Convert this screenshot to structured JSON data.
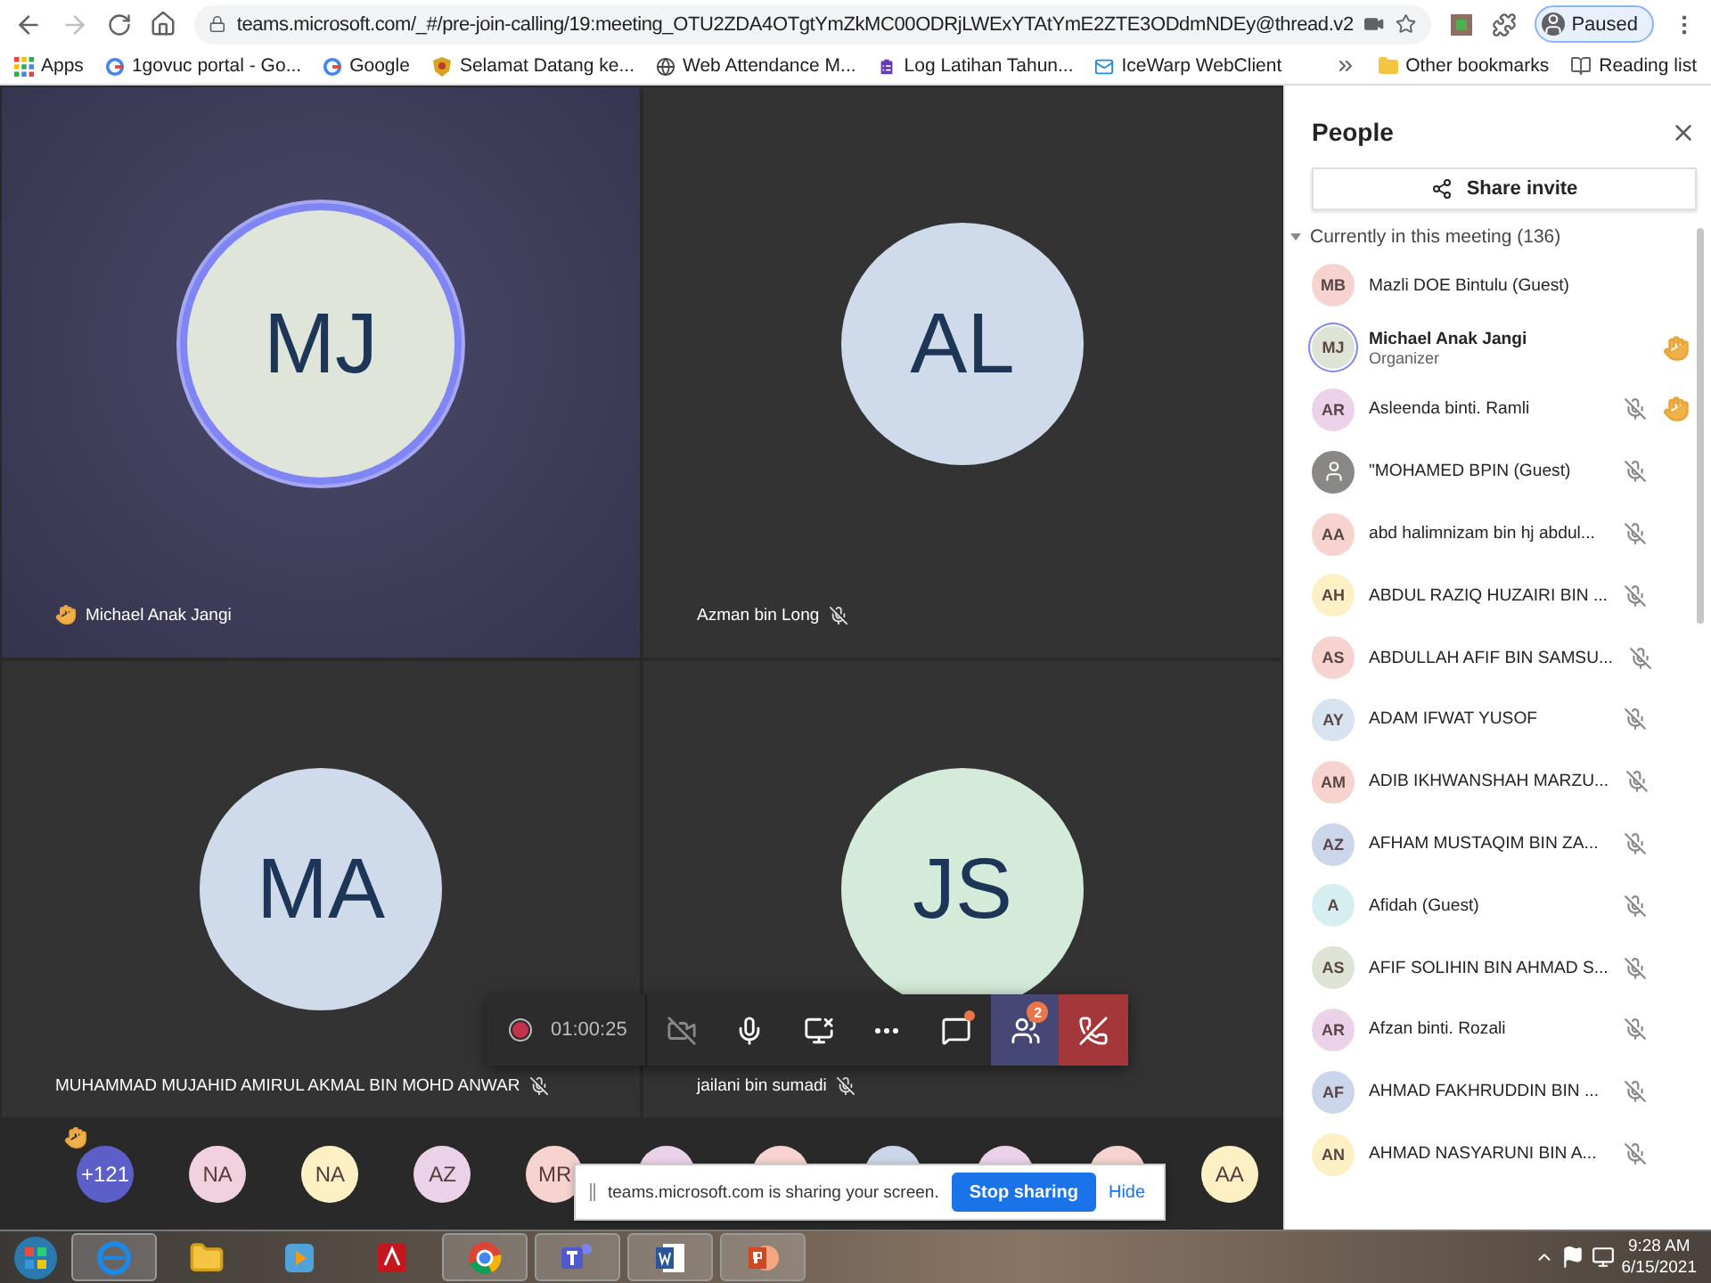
{
  "browser": {
    "url": "teams.microsoft.com/_#/pre-join-calling/19:meeting_OTU2ZDA4OTgtYmZkMC00ODRjLWExYTAtYmE2ZTE3ODdmNDEy@thread.v2",
    "profile": "Paused",
    "bookmarks": [
      {
        "label": "Apps",
        "kind": "apps"
      },
      {
        "label": "1govuc portal - Go...",
        "kind": "google"
      },
      {
        "label": "Google",
        "kind": "google"
      },
      {
        "label": "Selamat Datang ke...",
        "kind": "crest"
      },
      {
        "label": "Web Attendance M...",
        "kind": "globe"
      },
      {
        "label": "Log Latihan Tahun...",
        "kind": "form"
      },
      {
        "label": "IceWarp WebClient",
        "kind": "mail"
      }
    ],
    "other_bookmarks": "Other bookmarks",
    "reading_list": "Reading list"
  },
  "tiles": [
    {
      "initials": "MJ",
      "name": "Michael Anak Jangi",
      "speaking": true,
      "hand": true,
      "muted": false,
      "color": "#dfe5d8"
    },
    {
      "initials": "AL",
      "name": "Azman bin Long",
      "speaking": false,
      "hand": false,
      "muted": true,
      "color": "#cfdbea"
    },
    {
      "initials": "MA",
      "name": "MUHAMMAD MUJAHID AMIRUL AKMAL BIN MOHD ANWAR",
      "speaking": false,
      "hand": false,
      "muted": true,
      "color": "#cfdbea"
    },
    {
      "initials": "JS",
      "name": "jailani bin sumadi",
      "speaking": false,
      "hand": false,
      "muted": true,
      "color": "#d4ebd9"
    }
  ],
  "strip": [
    {
      "initials": "+121",
      "hand": true,
      "color": "#5b5fc7"
    },
    {
      "initials": "NA",
      "hand": false,
      "color": "#f1d0e0"
    },
    {
      "initials": "NA",
      "hand": false,
      "color": "#fcf0c4"
    },
    {
      "initials": "AZ",
      "hand": false,
      "color": "#ecd2e8"
    },
    {
      "initials": "MR",
      "hand": false,
      "color": "#f6d3cf"
    },
    {
      "hand": false,
      "color": "#ecd2e8"
    },
    {
      "hand": false,
      "color": "#f6d3cf"
    },
    {
      "hand": false,
      "color": "#ccd6ea"
    },
    {
      "hand": false,
      "color": "#ecd2e8"
    },
    {
      "hand": false,
      "color": "#f6d3cf"
    },
    {
      "initials": "AA",
      "hand": false,
      "color": "#fcf0c4"
    }
  ],
  "toolbar": {
    "timer": "01:00:25",
    "people_badge": "2",
    "chat_unread": true
  },
  "share_bar": {
    "text": "teams.microsoft.com is sharing your screen.",
    "button": "Stop sharing",
    "link": "Hide"
  },
  "people": {
    "title": "People",
    "share": "Share invite",
    "section": "Currently in this meeting (136)",
    "expanded": true,
    "participants": [
      {
        "initials": "MB",
        "name": "Mazli DOE Bintulu (Guest)",
        "kind": "initials",
        "color": "#f6d3cf",
        "muted": false,
        "hand": false
      },
      {
        "initials": "MJ",
        "name": "Michael Anak Jangi",
        "role": "Organizer",
        "kind": "initials",
        "color": "#dde3d5",
        "muted": false,
        "hand": true
      },
      {
        "initials": "AR",
        "name": "Asleenda binti. Ramli",
        "kind": "initials",
        "color": "#ecd2e8",
        "muted": true,
        "hand": true
      },
      {
        "name": "\"MOHAMED BPIN (Guest)",
        "kind": "guest",
        "color": "#8a8886",
        "muted": true,
        "hand": false
      },
      {
        "initials": "AA",
        "name": "abd halimnizam bin hj abdul...",
        "kind": "initials",
        "color": "#f6d3cf",
        "muted": true,
        "hand": false
      },
      {
        "initials": "AH",
        "name": "ABDUL RAZIQ HUZAIRI BIN ...",
        "kind": "initials",
        "color": "#fcf0c4",
        "muted": true,
        "hand": false
      },
      {
        "initials": "AS",
        "name": "ABDULLAH AFIF BIN SAMSU...",
        "kind": "initials",
        "color": "#f6d3cf",
        "muted": true,
        "hand": false
      },
      {
        "initials": "AY",
        "name": "ADAM IFWAT YUSOF",
        "kind": "initials",
        "color": "#d7e3ee",
        "muted": true,
        "hand": false
      },
      {
        "initials": "AM",
        "name": "ADIB IKHWANSHAH MARZU...",
        "kind": "initials",
        "color": "#f6d3cf",
        "muted": true,
        "hand": false
      },
      {
        "initials": "AZ",
        "name": "AFHAM MUSTAQIM BIN ZA...",
        "kind": "initials",
        "color": "#ccd6ea",
        "muted": true,
        "hand": false
      },
      {
        "initials": "A",
        "name": "Afidah (Guest)",
        "kind": "initials",
        "color": "#d7eef0",
        "muted": true,
        "hand": false
      },
      {
        "initials": "AS",
        "name": "AFIF SOLIHIN BIN AHMAD S...",
        "kind": "initials",
        "color": "#dde3d5",
        "muted": true,
        "hand": false
      },
      {
        "initials": "AR",
        "name": "Afzan binti. Rozali",
        "kind": "initials",
        "color": "#ecd2e8",
        "muted": true,
        "hand": false
      },
      {
        "initials": "AF",
        "name": "AHMAD FAKHRUDDIN BIN ...",
        "kind": "initials",
        "color": "#ccd6ea",
        "muted": true,
        "hand": false
      },
      {
        "initials": "AN",
        "name": "AHMAD NASYARUNI BIN A...",
        "kind": "initials",
        "color": "#fcf0c4",
        "muted": true,
        "hand": false
      }
    ]
  },
  "taskbar": {
    "time": "9:28 AM",
    "date": "6/15/2021"
  }
}
